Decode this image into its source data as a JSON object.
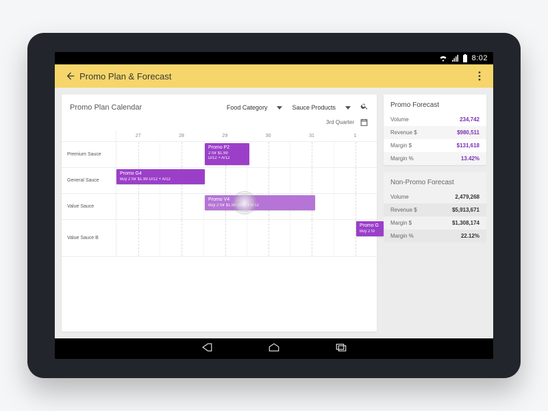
{
  "status": {
    "time": "8:02"
  },
  "appbar": {
    "title": "Promo Plan & Forecast"
  },
  "calendar": {
    "title": "Promo Plan Calendar",
    "category_dd": "Food Category",
    "product_dd": "Sauce Products",
    "period": "3rd Quarter",
    "columns": [
      "27",
      "28",
      "29",
      "30",
      "31",
      "1"
    ],
    "rows": [
      "Premium Sauce",
      "General Sauce",
      "Value Sauce",
      "Value Sauce B"
    ],
    "bars": [
      {
        "id": "p2",
        "name": "Promo P2",
        "line1": "2 for $1.99",
        "line2": "D/12 + A/12"
      },
      {
        "id": "g4",
        "name": "Promo G4",
        "line1": "Buy 2 for $1.99 D/12 + A/12",
        "line2": ""
      },
      {
        "id": "v4",
        "name": "Promo V4",
        "line1": "Buy 2 for $1.99 D/12 + A/12",
        "line2": ""
      },
      {
        "id": "g5",
        "name": "Promo G",
        "line1": "Buy 2 fo",
        "line2": ""
      }
    ]
  },
  "forecast": {
    "promo": {
      "title": "Promo Forecast",
      "rows": [
        {
          "k": "Volume",
          "v": "234,742"
        },
        {
          "k": "Revenue $",
          "v": "$980,511"
        },
        {
          "k": "Margin $",
          "v": "$131,618"
        },
        {
          "k": "Margin %",
          "v": "13.42%"
        }
      ]
    },
    "nonpromo": {
      "title": "Non-Promo Forecast",
      "rows": [
        {
          "k": "Volume",
          "v": "2,479,268"
        },
        {
          "k": "Revenue $",
          "v": "$5,913,671"
        },
        {
          "k": "Margin $",
          "v": "$1,308,174"
        },
        {
          "k": "Margin %",
          "v": "22.12%"
        }
      ]
    }
  }
}
